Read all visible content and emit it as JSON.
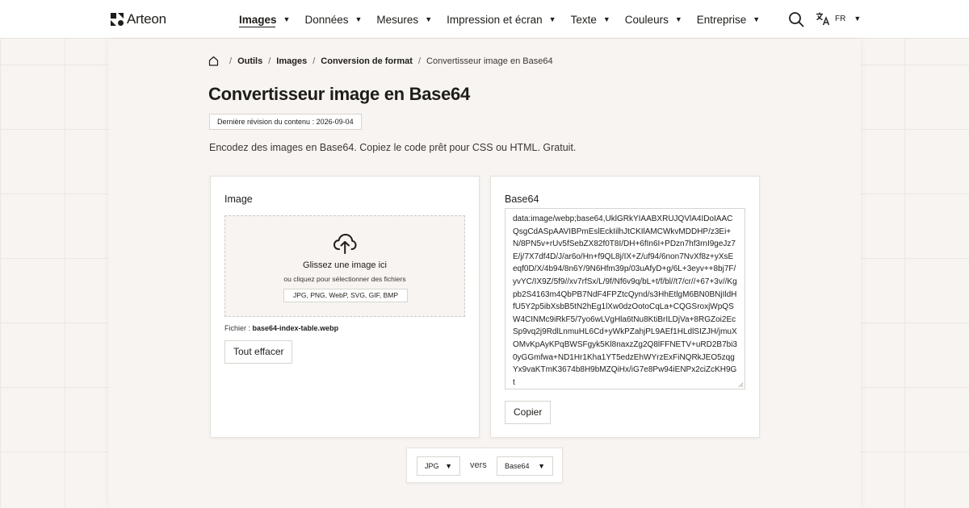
{
  "brand": {
    "name": "Arteon"
  },
  "nav": {
    "items": [
      {
        "label": "Images",
        "active": true
      },
      {
        "label": "Données",
        "active": false
      },
      {
        "label": "Mesures",
        "active": false
      },
      {
        "label": "Impression et écran",
        "active": false
      },
      {
        "label": "Texte",
        "active": false
      },
      {
        "label": "Couleurs",
        "active": false
      },
      {
        "label": "Entreprise",
        "active": false
      }
    ],
    "caret": "▼"
  },
  "header": {
    "search_icon": "search-icon",
    "lang_icon": "translate-icon",
    "lang_code": "FR"
  },
  "breadcrumb": {
    "home_icon": "home-icon",
    "separator": "/",
    "items": [
      "Outils",
      "Images",
      "Conversion de format"
    ],
    "current": "Convertisseur image en Base64"
  },
  "page": {
    "title": "Convertisseur image en Base64",
    "revision": "Dernière révision du contenu : 2026-09-04",
    "description": "Encodez des images en Base64. Copiez le code prêt pour CSS ou HTML. Gratuit."
  },
  "input_card": {
    "label": "Image",
    "dropzone": {
      "icon": "cloud-upload-icon",
      "title": "Glissez une image ici",
      "subtitle": "ou cliquez pour sélectionner des fichiers",
      "formats": "JPG, PNG, WebP, SVG, GIF, BMP"
    },
    "file_prefix": "Fichier :",
    "file_name": "base64-index-table.webp",
    "clear_label": "Tout effacer"
  },
  "output_card": {
    "label": "Base64",
    "value": "data:image/webp;base64,UklGRkYIAABXRUJQVlA4IDoIAACQsgCdASpAAVIBPmEslEckIilhJtCKIlAMCWkvMDDHP/z3Ei+N/8PN5v+rUv5fSebZX82f0T8I/DH+6fIn6I+PDzn7hf3rnI9geJz7E/j/7X7df4D/J/ar6o/Hn+f9QL8j/IX+Z/uf94/6non7NvXf8z+yXsEeqf0D/X/4b94/8n6Y/9N6Hfm39p/03uAfyD+g/6L+3eyv++8bj7F/yvYC/IX9Z/5f9//xv7rfSx/L/9f/Nf6v9q/bL+t/f/bl//t7/cr//+67+3v//Kgpb2S4163m4QbPB7NdF4FPZtcQynd/s3HhEtlgM6BN0BNjIldHfU5Y2p5ibXsbB5tN2hEg1lXw0dzOotoCqLa+CQGSroxjWpQSW4CINMc9iRkF5/7yo6wLVgHla6tNu8KtiBrILDjVa+8RGZoi2EcSp9vq2j9RdlLnmuHL6Cd+yWkPZahjPL9AEf1HLdlSIZJH/jmuXOMvKpAyKPqBWSFgyk5Kl8naxzZg2Q8lFFNETV+uRD2B7bi30yGGmfwa+ND1Hr1Kha1YT5edzEhWYrzExFiNQRkJEO5zqgYx9vaKTmK3674b8H9bMZQiHx/iG7e8Pw94iENPx2ciZcKH9Gt"
  },
  "controls": {
    "copy_label": "Copier"
  },
  "format_bar": {
    "from": "JPG",
    "connector": "vers",
    "to": "Base64",
    "caret": "▼"
  }
}
